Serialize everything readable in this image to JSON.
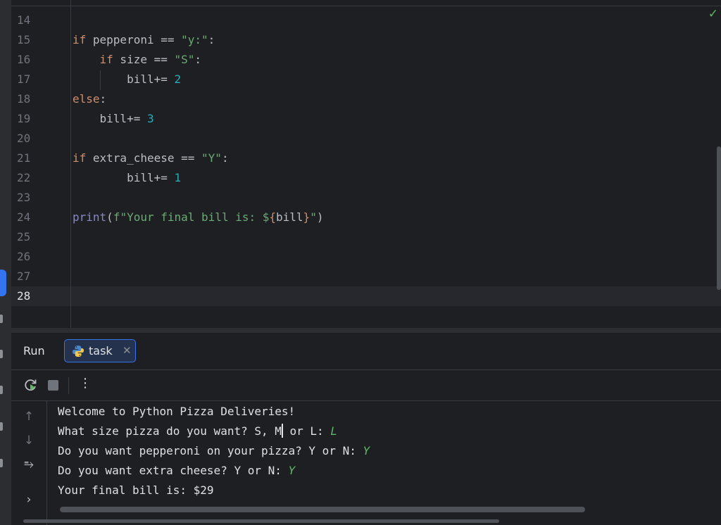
{
  "editor": {
    "lines": [
      {
        "n": "14"
      },
      {
        "n": "15",
        "parts": [
          {
            "t": "if",
            "c": "kw"
          },
          {
            "t": " pepperoni == "
          },
          {
            "t": "\"y:\"",
            "c": "str"
          },
          {
            "t": ":"
          }
        ]
      },
      {
        "n": "16",
        "parts": [
          {
            "t": "    "
          },
          {
            "t": "if",
            "c": "kw"
          },
          {
            "t": " size == "
          },
          {
            "t": "\"S\"",
            "c": "str"
          },
          {
            "t": ":"
          }
        ]
      },
      {
        "n": "17",
        "parts": [
          {
            "t": "        bill+= "
          },
          {
            "t": "2",
            "c": "num"
          }
        ]
      },
      {
        "n": "18",
        "parts": [
          {
            "t": "else",
            "c": "kw"
          },
          {
            "t": ":"
          }
        ]
      },
      {
        "n": "19",
        "parts": [
          {
            "t": "    bill+= "
          },
          {
            "t": "3",
            "c": "num"
          }
        ]
      },
      {
        "n": "20"
      },
      {
        "n": "21",
        "parts": [
          {
            "t": "if",
            "c": "kw"
          },
          {
            "t": " extra_cheese == "
          },
          {
            "t": "\"Y\"",
            "c": "str"
          },
          {
            "t": ":"
          }
        ]
      },
      {
        "n": "22",
        "parts": [
          {
            "t": "        bill+= "
          },
          {
            "t": "1",
            "c": "num"
          }
        ]
      },
      {
        "n": "23"
      },
      {
        "n": "24",
        "parts": [
          {
            "t": "print",
            "c": "fn"
          },
          {
            "t": "("
          },
          {
            "t": "f\"Your final bill is: $",
            "c": "str"
          },
          {
            "t": "{",
            "c": "brace"
          },
          {
            "t": "bill"
          },
          {
            "t": "}",
            "c": "brace"
          },
          {
            "t": "\"",
            "c": "str"
          },
          {
            "t": ")"
          }
        ]
      },
      {
        "n": "25"
      },
      {
        "n": "26"
      },
      {
        "n": "27"
      },
      {
        "n": "28",
        "current": true
      }
    ]
  },
  "run": {
    "title": "Run",
    "tab_label": "task",
    "tab_close": "✕",
    "more": "⋮"
  },
  "console": {
    "lines": [
      {
        "text": "Welcome to Python Pizza Deliveries!"
      },
      {
        "text": "What size pizza do you want? S, M",
        "caret": true,
        "rest": " or L: ",
        "input": "L"
      },
      {
        "text": "Do you want pepperoni on your pizza? Y or N: ",
        "input": "Y"
      },
      {
        "text": "Do you want extra cheese? Y or N: ",
        "input": "Y"
      },
      {
        "text": "Your final bill is: $29"
      }
    ]
  },
  "icons": {
    "check": "✓",
    "up": "↑",
    "down": "↓",
    "wrap": "⥱",
    "expand": "›"
  },
  "colors": {
    "keyword": "#cf8e6d",
    "string": "#6aab73",
    "number": "#2aacb8",
    "builtin": "#8888c6",
    "accent": "#3574f0",
    "input": "#5fb865"
  }
}
